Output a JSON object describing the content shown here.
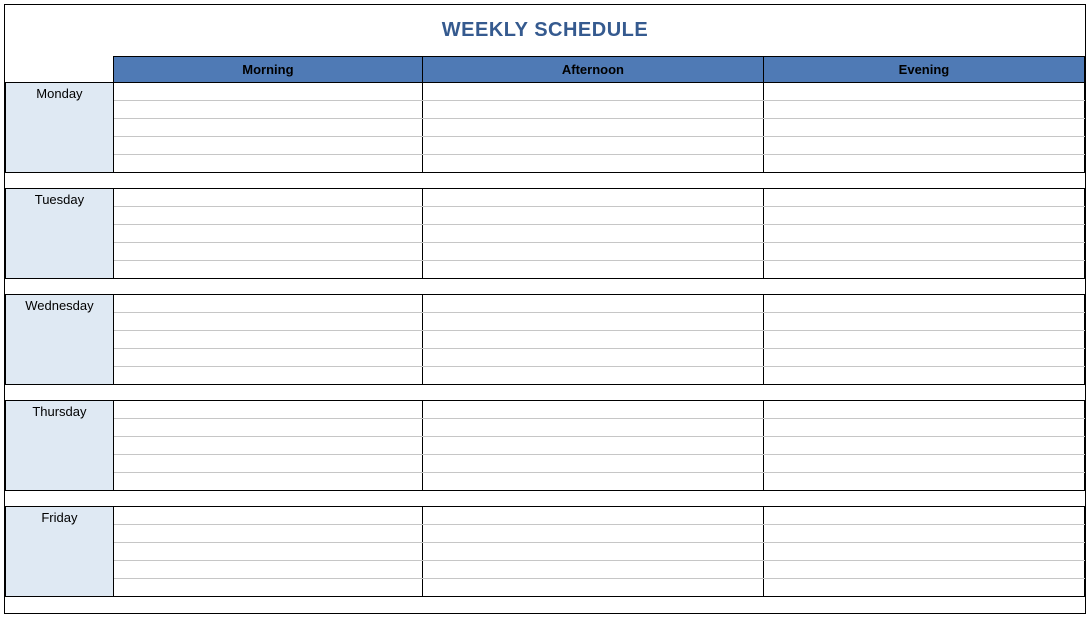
{
  "title": "WEEKLY SCHEDULE",
  "columns": {
    "morning": "Morning",
    "afternoon": "Afternoon",
    "evening": "Evening"
  },
  "days": {
    "monday": "Monday",
    "tuesday": "Tuesday",
    "wednesday": "Wednesday",
    "thursday": "Thursday",
    "friday": "Friday"
  },
  "colors": {
    "header_bg": "#4f7ab5",
    "day_bg": "#dfe9f3",
    "title_color": "#355a8f"
  }
}
